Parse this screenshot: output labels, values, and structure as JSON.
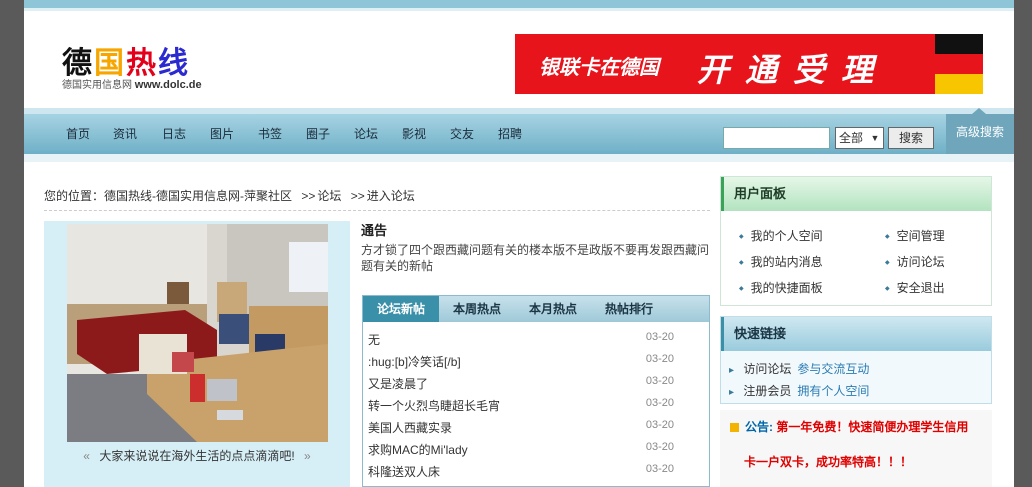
{
  "logo": {
    "chars": [
      "德",
      "国",
      "热",
      "线"
    ],
    "tagline": "德国实用信息网",
    "domain": "www.dolc.de"
  },
  "banner": {
    "left_text": "银联卡在德国",
    "right_text": "开通受理"
  },
  "nav": {
    "items": [
      "首页",
      "资讯",
      "日志",
      "图片",
      "书签",
      "圈子",
      "论坛",
      "影视",
      "交友",
      "招聘"
    ]
  },
  "search": {
    "input_value": "",
    "select_value": "全部",
    "button_label": "搜索",
    "advanced_label": "高级搜索"
  },
  "breadcrumb": {
    "prefix": "您的位置：",
    "site": "德国热线-德国实用信息网-萍聚社区",
    "sep1": ">>",
    "forum": "论坛",
    "sep2": ">>",
    "enter": "进入论坛"
  },
  "photo_box": {
    "caption": "大家来说说在海外生活的点点滴滴吧!",
    "prev": "«",
    "next": "»"
  },
  "notice": {
    "title": "通告",
    "body": "方才锁了四个跟西藏问题有关的楼本版不是政版不要再发跟西藏问题有关的新帖"
  },
  "forum_tabs": [
    "论坛新帖",
    "本周热点",
    "本月热点",
    "热帖排行"
  ],
  "posts": [
    {
      "title": "无",
      "date": "03-20"
    },
    {
      "title": ":hug:[b]冷笑话[/b]",
      "date": "03-20"
    },
    {
      "title": "又是凌晨了",
      "date": "03-20"
    },
    {
      "title": "转一个火烈鸟睫超长毛宵",
      "date": "03-20"
    },
    {
      "title": "美国人西藏实录",
      "date": "03-20"
    },
    {
      "title": "求购MAC的Mi'lady",
      "date": "03-20"
    },
    {
      "title": "科隆送双人床",
      "date": "03-20"
    }
  ],
  "user_panel": {
    "title": "用户面板",
    "links": [
      "我的个人空间",
      "空间管理",
      "我的站内消息",
      "访问论坛",
      "我的快捷面板",
      "安全退出"
    ]
  },
  "quick_links": {
    "title": "快速链接",
    "rows": [
      {
        "label": "访问论坛",
        "sub": "参与交流互动"
      },
      {
        "label": "注册会员",
        "sub": "拥有个人空间"
      }
    ]
  },
  "ad": {
    "label": "公告:",
    "line1": "第一年免费！快速简便办理学生信用",
    "line2": "卡一户双卡，成功率特高！！！"
  },
  "colors": {
    "accent": "#3a8fa9",
    "nav_bg": "#8ec6d8",
    "banner_red": "#e8141c",
    "user_green": "#37a457"
  }
}
